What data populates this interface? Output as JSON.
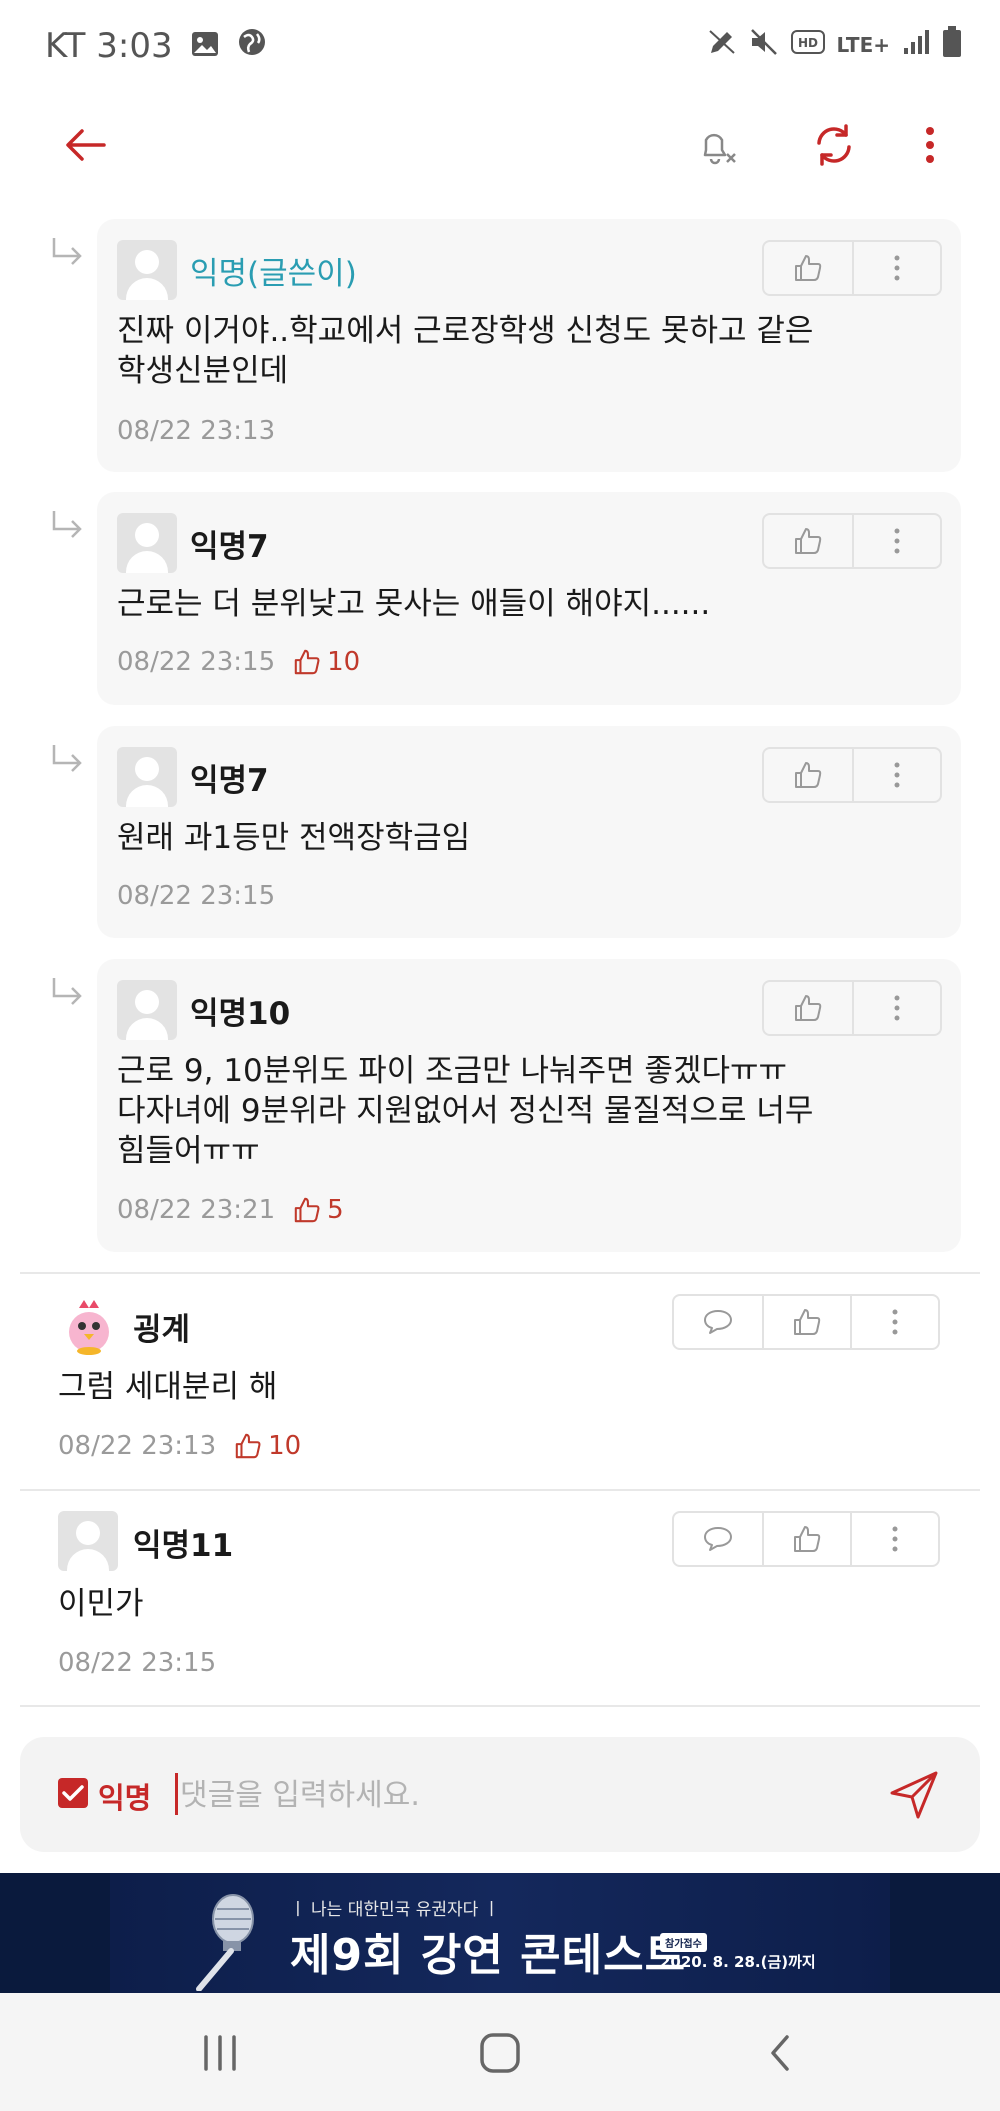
{
  "status_bar": {
    "carrier_time": "KT 3:03",
    "network": "LTE+"
  },
  "top_bar": {
    "icons": [
      "back-arrow-icon",
      "notification-off-icon",
      "refresh-icon",
      "more-vert-icon"
    ]
  },
  "replies": [
    {
      "author": "익명(글쓴이)",
      "is_op": true,
      "content_lines": [
        "진짜 이거야..학교에서 근로장학생 신청도 못하고 같은",
        "학생신분인데"
      ],
      "time": "08/22 23:13",
      "likes": ""
    },
    {
      "author": "익명7",
      "is_op": false,
      "content_lines": [
        "근로는 더 분위낮고 못사는 애들이 해야지......"
      ],
      "time": "08/22 23:15",
      "likes": "10"
    },
    {
      "author": "익명7",
      "is_op": false,
      "content_lines": [
        "원래 과1등만 전액장학금임"
      ],
      "time": "08/22 23:15",
      "likes": ""
    },
    {
      "author": "익명10",
      "is_op": false,
      "content_lines": [
        "근로 9, 10분위도 파이 조금만 나눠주면 좋겠다ㅠㅠ",
        "다자녀에 9분위라 지원없어서 정신적 물질적으로 너무",
        "힘들어ㅠㅠ"
      ],
      "time": "08/22 23:21",
      "likes": "5"
    }
  ],
  "comments": [
    {
      "author": "굉계",
      "content": "그럼 세대분리 해",
      "time": "08/22 23:13",
      "likes": "10"
    },
    {
      "author": "익명11",
      "content": "이민가",
      "time": "08/22 23:15",
      "likes": ""
    }
  ],
  "input_bar": {
    "anonymous_label": "익명",
    "anonymous_checked": true,
    "placeholder": "댓글을 입력하세요."
  },
  "banner": {
    "top_text": "ㅣ 나는 대한민국 유권자다 ㅣ",
    "title": "제9회 강연 콘테스트",
    "badge": "참가접수",
    "date": "2020. 8. 28.(금)까지"
  },
  "colors": {
    "accent": "#c62828",
    "op_author": "#2a9db2",
    "card_bg": "#f7f7f7",
    "meta": "#9a9a9a"
  }
}
